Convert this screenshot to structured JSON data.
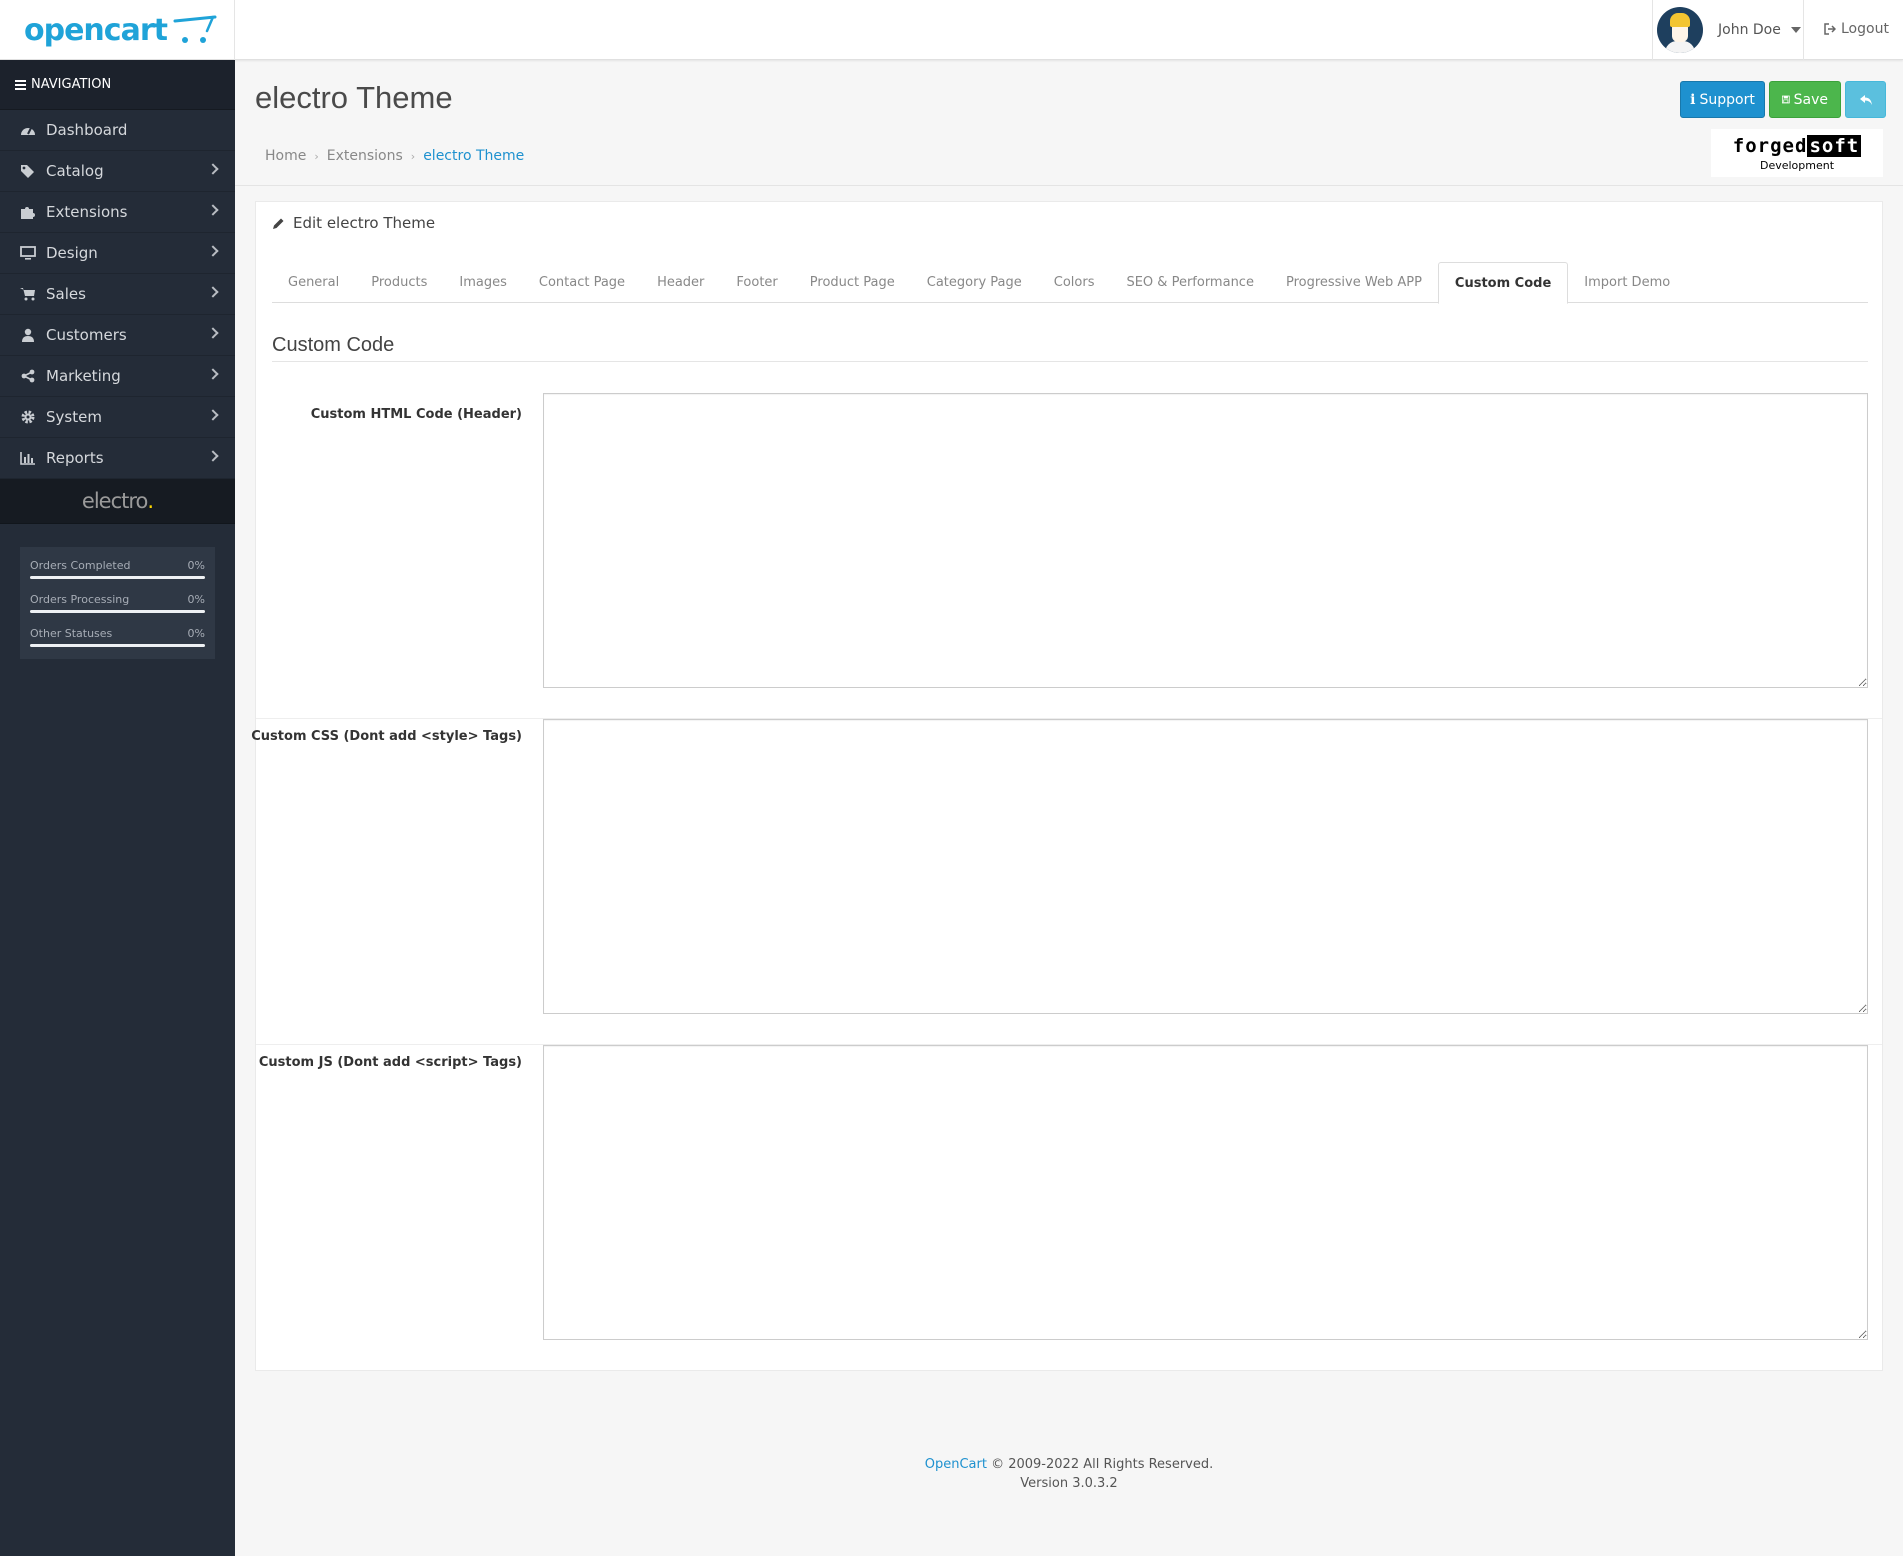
{
  "header": {
    "logo_text": "opencart",
    "user_name": "John Doe",
    "logout_label": "Logout"
  },
  "sidebar": {
    "nav_title": "NAVIGATION",
    "items": [
      {
        "label": "Dashboard",
        "icon": "dashboard-icon",
        "has_children": false
      },
      {
        "label": "Catalog",
        "icon": "tags-icon",
        "has_children": true
      },
      {
        "label": "Extensions",
        "icon": "puzzle-icon",
        "has_children": true
      },
      {
        "label": "Design",
        "icon": "monitor-icon",
        "has_children": true
      },
      {
        "label": "Sales",
        "icon": "cart-icon",
        "has_children": true
      },
      {
        "label": "Customers",
        "icon": "user-icon",
        "has_children": true
      },
      {
        "label": "Marketing",
        "icon": "share-icon",
        "has_children": true
      },
      {
        "label": "System",
        "icon": "cog-icon",
        "has_children": true
      },
      {
        "label": "Reports",
        "icon": "bar-chart-icon",
        "has_children": true
      }
    ],
    "brand": "electro",
    "brand_dot": ".",
    "stats": [
      {
        "label": "Orders Completed",
        "value": "0%",
        "fraction": 0
      },
      {
        "label": "Orders Processing",
        "value": "0%",
        "fraction": 0
      },
      {
        "label": "Other Statuses",
        "value": "0%",
        "fraction": 0
      }
    ]
  },
  "page": {
    "title": "electro Theme",
    "breadcrumb": [
      "Home",
      "Extensions",
      "electro Theme"
    ],
    "buttons": {
      "support": "Support",
      "save": "Save"
    },
    "vendor_logo": {
      "part1": "forged",
      "part2": "soft",
      "sub": "Development"
    }
  },
  "panel": {
    "heading": "Edit electro Theme",
    "tabs": [
      "General",
      "Products",
      "Images",
      "Contact Page",
      "Header",
      "Footer",
      "Product Page",
      "Category Page",
      "Colors",
      "SEO & Performance",
      "Progressive Web APP",
      "Custom Code",
      "Import Demo"
    ],
    "active_tab": "Custom Code",
    "section_title": "Custom Code",
    "fields": [
      {
        "label": "Custom HTML Code (Header)",
        "value": ""
      },
      {
        "label": "Custom CSS (Dont add <style> Tags)",
        "value": ""
      },
      {
        "label": "Custom JS (Dont add <script> Tags)",
        "value": ""
      }
    ]
  },
  "footer": {
    "link": "OpenCart",
    "copyright": "© 2009-2022 All Rights Reserved.",
    "version": "Version 3.0.3.2"
  },
  "colors": {
    "accent": "#1e91cf",
    "save": "#4cb64c",
    "back": "#5bc0de",
    "sidebar_bg": "#242c38",
    "brand_yellow": "#fed700"
  }
}
